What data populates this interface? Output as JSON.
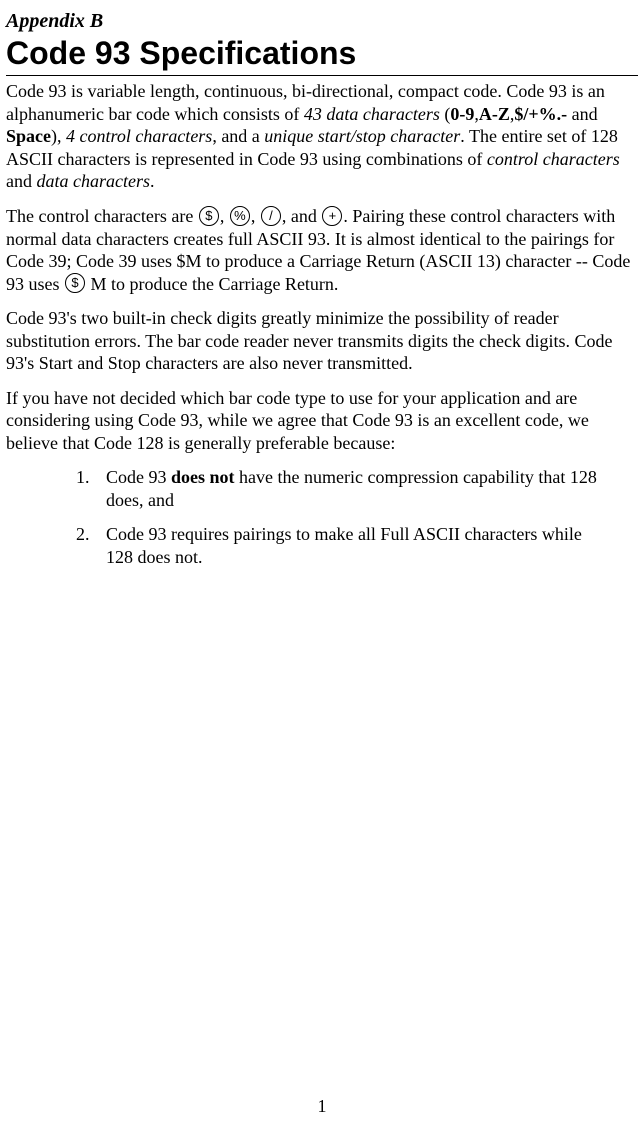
{
  "appendix_label": "Appendix B",
  "title": "Code 93 Specifications",
  "p1_a": "Code 93 is variable length, continuous, bi-directional, compact code.  Code 93 is an alphanumeric bar code which consists of ",
  "p1_b": "43 data characters",
  "p1_c": " (",
  "p1_d": "0-9",
  "p1_e": ",",
  "p1_f": "A-Z",
  "p1_g": ",",
  "p1_h": "$/+%.-",
  "p1_i": " and ",
  "p1_j": "Space",
  "p1_k": "), ",
  "p1_l": "4 control characters",
  "p1_m": ", and a ",
  "p1_n": "unique start/stop character",
  "p1_o": ".  The entire set of 128 ASCII characters is represented in Code 93 using combinations of ",
  "p1_p": "control characters",
  "p1_q": " and ",
  "p1_r": "data characters",
  "p1_s": ".",
  "p2_a": "The control characters are ",
  "p2_b": ",  ",
  "p2_c": ",  ",
  "p2_d": ", and ",
  "p2_e": ".  Pairing these control characters with normal data characters creates full ASCII 93.  It is almost identical to the pairings for Code 39; Code 39 uses $M to produce a Carriage Return (ASCII 13) character -- Code 93 uses ",
  "p2_f": " M to produce the Carriage Return.",
  "icons": {
    "dollar": "$",
    "percent": "%",
    "slash": "/",
    "plus": "+"
  },
  "p3": "Code 93's two built-in check digits greatly minimize the possibility of reader substitution errors. The bar code reader never transmits digits the check digits.  Code 93's Start and Stop characters are also never transmitted.",
  "p4": "If you have not decided which bar code type to use for your application and are considering using Code 93, while we agree that Code 93 is an excellent code, we believe that Code 128 is generally preferable because:",
  "list": [
    {
      "num": "1.",
      "a": "Code 93 ",
      "b": "does not",
      "c": " have the numeric compression capability that 128 does, and"
    },
    {
      "num": "2.",
      "a": "Code 93 requires pairings to make all Full ASCII characters while 128 does not.",
      "b": "",
      "c": ""
    }
  ],
  "page_number": "1"
}
